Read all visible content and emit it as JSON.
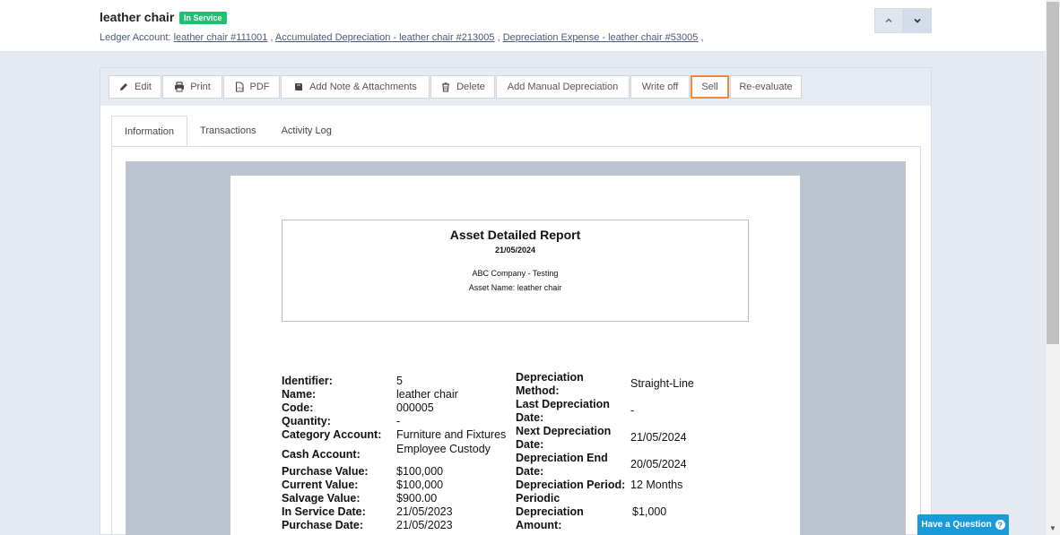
{
  "header": {
    "title": "leather chair",
    "status": "In Service",
    "ledger_label": "Ledger Account:",
    "ledger_links": [
      "leather chair #111001",
      "Accumulated Depreciation - leather chair #213005",
      "Depreciation Expense - leather chair #53005"
    ]
  },
  "toolbar": {
    "edit": "Edit",
    "print": "Print",
    "pdf": "PDF",
    "add_note": "Add Note & Attachments",
    "delete": "Delete",
    "add_manual_depreciation": "Add Manual Depreciation",
    "write_off": "Write off",
    "sell": "Sell",
    "re_evaluate": "Re-evaluate"
  },
  "tabs": [
    "Information",
    "Transactions",
    "Activity Log"
  ],
  "report": {
    "title": "Asset Detailed Report",
    "date": "21/05/2024",
    "company": "ABC Company - Testing",
    "asset_name": "Asset Name: leather chair",
    "left_fields": [
      {
        "label": "Identifier:",
        "value": "5"
      },
      {
        "label": "Name:",
        "value": "leather chair"
      },
      {
        "label": "Code:",
        "value": "000005"
      },
      {
        "label": "Quantity:",
        "value": "-"
      },
      {
        "label": "Category Account:",
        "value": "Furniture and Fixtures"
      },
      {
        "label": "Cash Account:",
        "value": "Employee Custody"
      },
      {
        "label": "Purchase Value:",
        "value": "$100,000"
      },
      {
        "label": "Current Value:",
        "value": "$100,000"
      },
      {
        "label": "Salvage Value:",
        "value": "$900.00"
      },
      {
        "label": "In Service Date:",
        "value": "21/05/2023"
      },
      {
        "label": "Purchase Date:",
        "value": "21/05/2023"
      }
    ],
    "right_fields": [
      {
        "label_1": "Depreciation",
        "label_2": "Method:",
        "value": "Straight-Line"
      },
      {
        "label_1": "Last Depreciation",
        "label_2": "Date:",
        "value": "-"
      },
      {
        "label_1": "Next Depreciation",
        "label_2": "Date:",
        "value": "21/05/2024"
      },
      {
        "label_1": "Depreciation End",
        "label_2": "Date:",
        "value": "20/05/2024"
      },
      {
        "label_1": "Depreciation Period:",
        "value": "12 Months"
      },
      {
        "label_1": "Periodic",
        "label_2": "Depreciation",
        "label_3": "Amount:",
        "value": "$1,000"
      }
    ]
  },
  "help": {
    "label": "Have a Question",
    "icon": "question-icon"
  }
}
